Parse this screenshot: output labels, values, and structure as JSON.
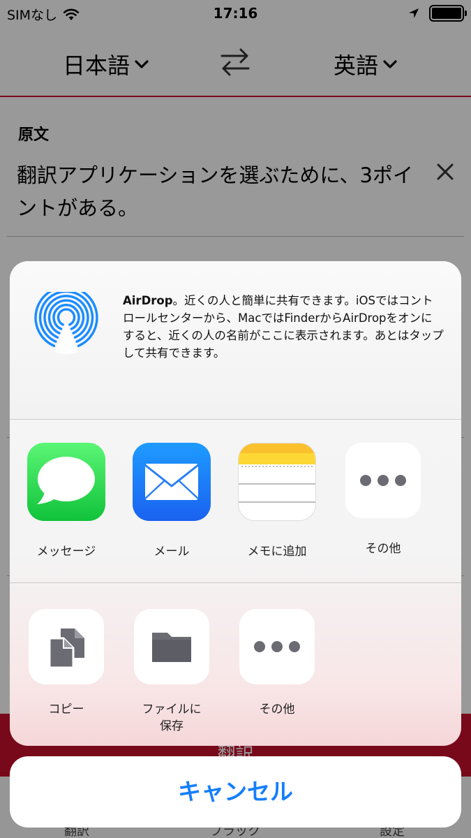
{
  "status": {
    "carrier": "SIMなし",
    "time": "17:16"
  },
  "header": {
    "source_lang": "日本語",
    "target_lang": "英語"
  },
  "source": {
    "label": "原文",
    "text": "翻訳アプリケーションを選ぶために、3ポイントがある。"
  },
  "translate_button": "翻訳",
  "tabs": [
    "翻訳",
    "ブラック",
    "設定"
  ],
  "share": {
    "airdrop_title": "AirDrop",
    "airdrop_text": "。近くの人と簡単に共有できます。iOSではコントロールセンターから、MacではFinderからAirDropをオンにすると、近くの人の名前がここに表示されます。あとはタップして共有できます。",
    "apps": [
      {
        "label": "メッセージ",
        "icon": "messages-icon"
      },
      {
        "label": "メール",
        "icon": "mail-icon"
      },
      {
        "label": "メモに追加",
        "icon": "notes-icon"
      },
      {
        "label": "その他",
        "icon": "more-icon"
      }
    ],
    "actions": [
      {
        "label": "コピー",
        "icon": "copy-icon"
      },
      {
        "label": "ファイルに\n保存",
        "icon": "folder-icon"
      },
      {
        "label": "その他",
        "icon": "more-icon"
      }
    ],
    "cancel": "キャンセル"
  },
  "colors": {
    "accent": "#c8102e",
    "ios_blue": "#157efb",
    "airdrop_blue": "#1a8cff",
    "action_gray": "#6b6b73"
  }
}
